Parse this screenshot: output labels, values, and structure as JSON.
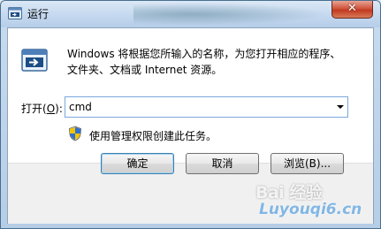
{
  "window": {
    "title": "运行",
    "close_glyph": "✕"
  },
  "content": {
    "description_line1": "Windows 将根据您所输入的名称，为您打开相应的程序、",
    "description_line2": "文件夹、文档或 Internet 资源。",
    "open_label_prefix": "打开(",
    "open_label_accel": "O",
    "open_label_suffix": "):",
    "open_value": "cmd",
    "admin_note": "使用管理权限创建此任务。"
  },
  "buttons": {
    "ok": "确定",
    "cancel": "取消",
    "browse": "浏览(B)..."
  },
  "icons": {
    "app": "run-dialog-icon",
    "run": "run-dialog-icon",
    "shield": "uac-shield-icon",
    "dropdown": "chevron-down-icon"
  },
  "watermark": {
    "line1": "Bai 经验",
    "line2": "Luyouqi6.cn"
  },
  "colors": {
    "title_bar": "#c4d8ef",
    "close_button": "#c9452c",
    "input_border": "#7aa7dd",
    "footer": "#f0f0f0"
  }
}
